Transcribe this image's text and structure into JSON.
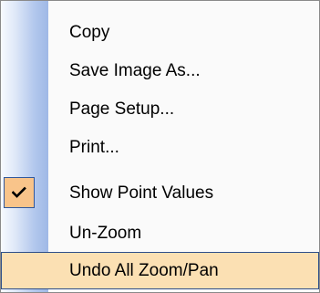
{
  "context_menu": {
    "items": [
      {
        "label": "Copy"
      },
      {
        "label": "Save Image As..."
      },
      {
        "label": "Page Setup..."
      },
      {
        "label": "Print..."
      },
      {
        "label": "Show Point Values",
        "checked": true
      },
      {
        "label": "Un-Zoom"
      },
      {
        "label": "Undo All Zoom/Pan",
        "highlighted": true
      }
    ]
  },
  "colors": {
    "check_background": "#f9c48a",
    "highlight_background": "#fbe0b3",
    "highlight_border": "#2e4f8a",
    "gutter_gradient_end": "#9fb8e6"
  },
  "icons": {
    "check": "checkmark-icon"
  }
}
